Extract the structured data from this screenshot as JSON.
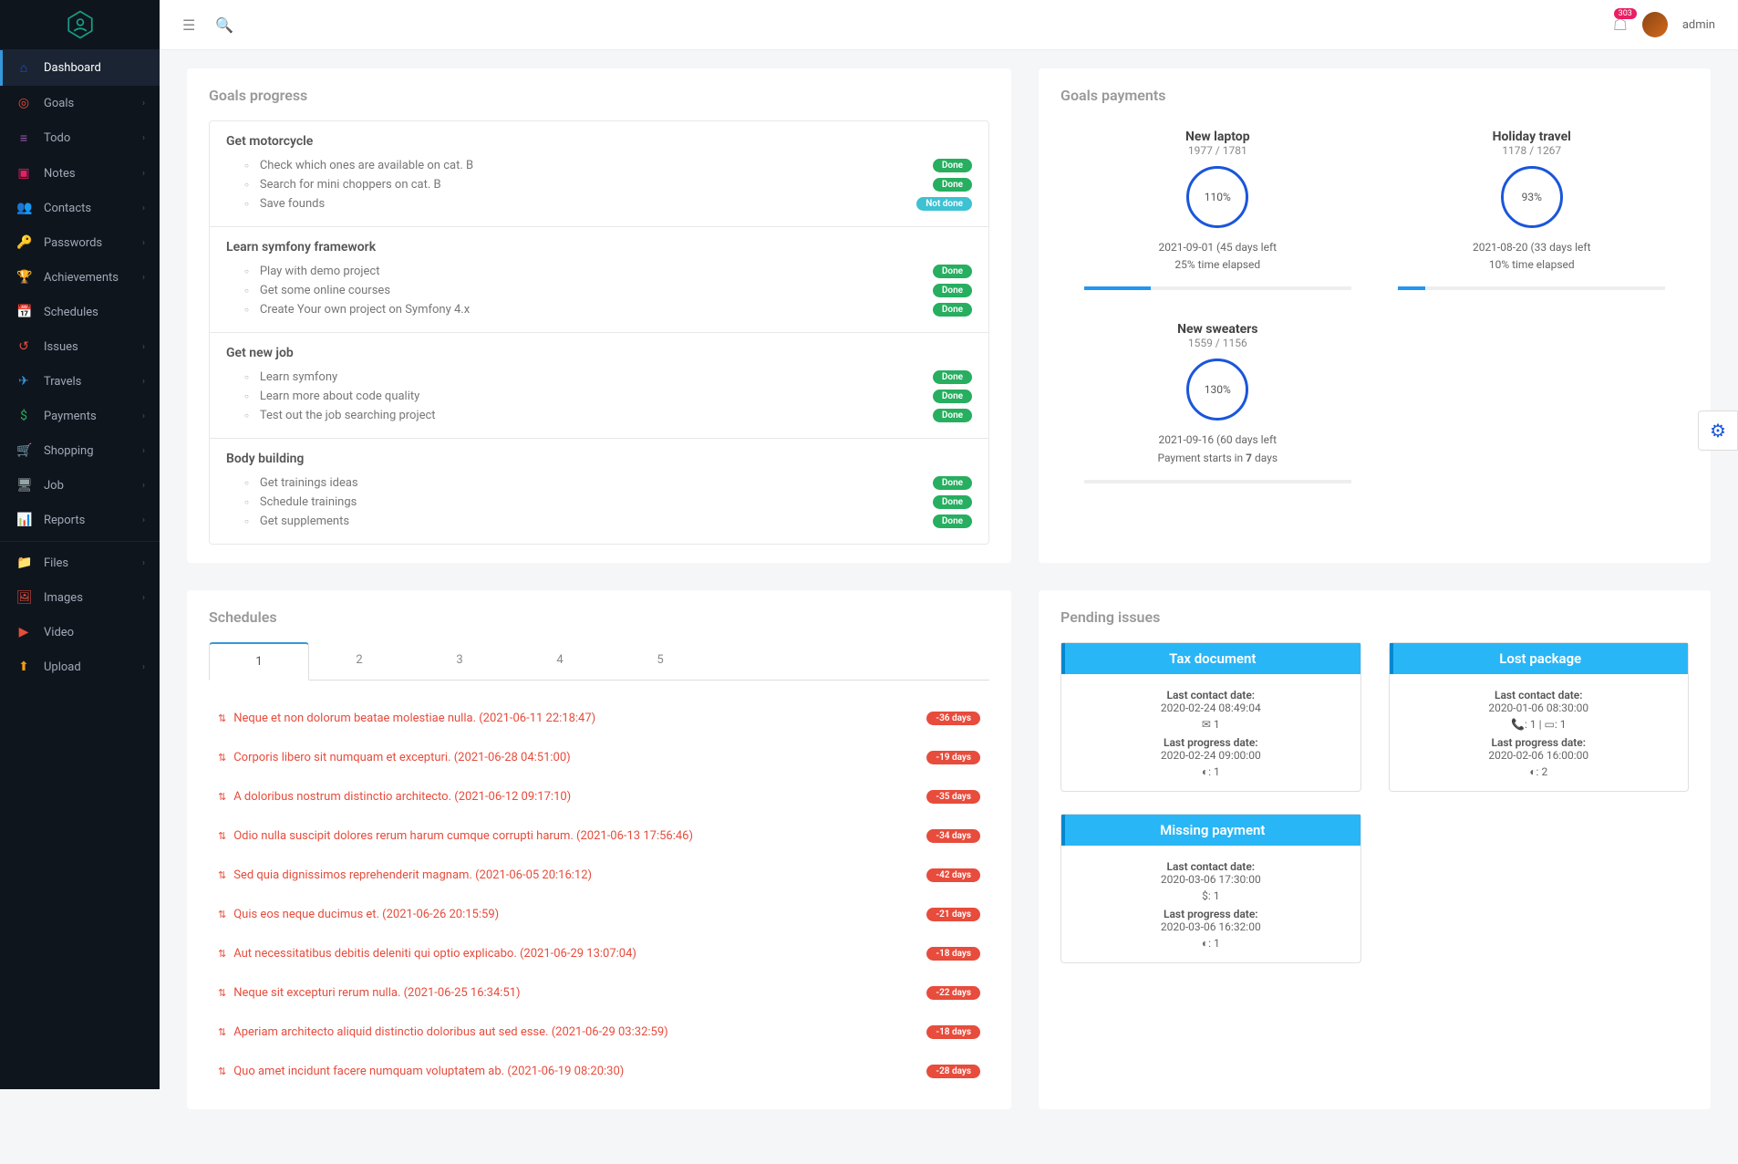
{
  "topbar": {
    "notif_count": "303",
    "username": "admin"
  },
  "sidebar": [
    {
      "icon": "⌂",
      "color": "#1a56db",
      "label": "Dashboard",
      "active": true
    },
    {
      "icon": "◎",
      "color": "#e74c3c",
      "label": "Goals",
      "chev": true
    },
    {
      "icon": "≡",
      "color": "#9b59b6",
      "label": "Todo",
      "chev": true
    },
    {
      "icon": "▣",
      "color": "#e91e63",
      "label": "Notes",
      "chev": true
    },
    {
      "icon": "👥",
      "color": "#e67e22",
      "label": "Contacts",
      "chev": true
    },
    {
      "icon": "🔑",
      "color": "#f1c40f",
      "label": "Passwords",
      "chev": true
    },
    {
      "icon": "🏆",
      "color": "#f39c12",
      "label": "Achievements",
      "chev": true
    },
    {
      "icon": "📅",
      "color": "#3498db",
      "label": "Schedules"
    },
    {
      "icon": "↺",
      "color": "#e74c3c",
      "label": "Issues",
      "chev": true
    },
    {
      "icon": "✈",
      "color": "#3498db",
      "label": "Travels",
      "chev": true
    },
    {
      "icon": "$",
      "color": "#27ae60",
      "label": "Payments",
      "chev": true
    },
    {
      "icon": "🛒",
      "color": "#95a5a6",
      "label": "Shopping",
      "chev": true
    },
    {
      "icon": "🖥",
      "color": "#95a5a6",
      "label": "Job",
      "chev": true
    },
    {
      "icon": "📊",
      "color": "#3498db",
      "label": "Reports",
      "chev": true
    },
    {
      "divider": true
    },
    {
      "icon": "📁",
      "color": "#f1c40f",
      "label": "Files",
      "chev": true
    },
    {
      "icon": "🖼",
      "color": "#e74c3c",
      "label": "Images",
      "chev": true
    },
    {
      "icon": "▶",
      "color": "#e74c3c",
      "label": "Video"
    },
    {
      "icon": "⬆",
      "color": "#f39c12",
      "label": "Upload",
      "chev": true
    }
  ],
  "goals_progress": {
    "title": "Goals progress",
    "groups": [
      {
        "name": "Get motorcycle",
        "items": [
          {
            "text": "Check which ones are available on cat. B",
            "status": "Done"
          },
          {
            "text": "Search for mini choppers on cat. B",
            "status": "Done"
          },
          {
            "text": "Save founds",
            "status": "Not done"
          }
        ]
      },
      {
        "name": "Learn symfony framework",
        "items": [
          {
            "text": "Play with demo project",
            "status": "Done"
          },
          {
            "text": "Get some online courses",
            "status": "Done"
          },
          {
            "text": "Create Your own project on Symfony 4.x",
            "status": "Done"
          }
        ]
      },
      {
        "name": "Get new job",
        "items": [
          {
            "text": "Learn symfony",
            "status": "Done"
          },
          {
            "text": "Learn more about code quality",
            "status": "Done"
          },
          {
            "text": "Test out the job searching project",
            "status": "Done"
          }
        ]
      },
      {
        "name": "Body building",
        "items": [
          {
            "text": "Get trainings ideas",
            "status": "Done"
          },
          {
            "text": "Schedule trainings",
            "status": "Done"
          },
          {
            "text": "Get supplements",
            "status": "Done"
          }
        ]
      }
    ]
  },
  "goals_payments": {
    "title": "Goals payments",
    "items": [
      {
        "title": "New laptop",
        "sub": "1977 / 1781",
        "pct": "110%",
        "line1": "2021-09-01 (45 days left",
        "line2": "25% time elapsed",
        "bar": 25
      },
      {
        "title": "Holiday travel",
        "sub": "1178 / 1267",
        "pct": "93%",
        "line1": "2021-08-20 (33 days left",
        "line2": "10% time elapsed",
        "bar": 10
      },
      {
        "title": "New sweaters",
        "sub": "1559 / 1156",
        "pct": "130%",
        "line1": "2021-09-16 (60 days left",
        "line2": "Payment starts in 7 days",
        "bar": 0,
        "bold7": true
      }
    ]
  },
  "schedules": {
    "title": "Schedules",
    "tabs": [
      "1",
      "2",
      "3",
      "4",
      "5"
    ],
    "items": [
      {
        "text": "Neque et non dolorum beatae molestiae nulla. (2021-06-11 22:18:47)",
        "days": "-36 days"
      },
      {
        "text": "Corporis libero sit numquam et excepturi. (2021-06-28 04:51:00)",
        "days": "-19 days"
      },
      {
        "text": "A doloribus nostrum distinctio architecto. (2021-06-12 09:17:10)",
        "days": "-35 days"
      },
      {
        "text": "Odio nulla suscipit dolores rerum harum cumque corrupti harum. (2021-06-13 17:56:46)",
        "days": "-34 days"
      },
      {
        "text": "Sed quia dignissimos reprehenderit magnam. (2021-06-05 20:16:12)",
        "days": "-42 days"
      },
      {
        "text": "Quis eos neque ducimus et. (2021-06-26 20:15:59)",
        "days": "-21 days"
      },
      {
        "text": "Aut necessitatibus debitis deleniti qui optio explicabo. (2021-06-29 13:07:04)",
        "days": "-18 days"
      },
      {
        "text": "Neque sit excepturi rerum nulla. (2021-06-25 16:34:51)",
        "days": "-22 days"
      },
      {
        "text": "Aperiam architecto aliquid distinctio doloribus aut sed esse. (2021-06-29 03:32:59)",
        "days": "-18 days"
      },
      {
        "text": "Quo amet incidunt facere numquam voluptatem ab. (2021-06-19 08:20:30)",
        "days": "-28 days"
      }
    ]
  },
  "issues": {
    "title": "Pending issues",
    "cols": [
      [
        {
          "title": "Tax document",
          "contact_lbl": "Last contact date:",
          "contact": "2020-02-24 08:49:04",
          "meta": "✉ 1",
          "progress_lbl": "Last progress date:",
          "progress": "2020-02-24 09:00:00",
          "meta2": "◐: 1"
        },
        {
          "title": "Missing payment",
          "contact_lbl": "Last contact date:",
          "contact": "2020-03-06 17:30:00",
          "meta": "$: 1",
          "progress_lbl": "Last progress date:",
          "progress": "2020-03-06 16:32:00",
          "meta2": "◐: 1"
        }
      ],
      [
        {
          "title": "Lost package",
          "contact_lbl": "Last contact date:",
          "contact": "2020-01-06 08:30:00",
          "meta": "📞: 1 | ▭: 1",
          "progress_lbl": "Last progress date:",
          "progress": "2020-02-06 16:00:00",
          "meta2": "◐: 2"
        }
      ]
    ]
  }
}
